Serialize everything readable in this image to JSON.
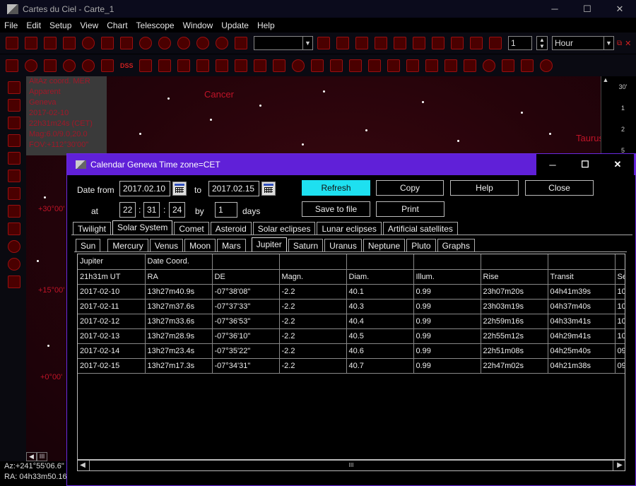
{
  "app": {
    "title": "Cartes du Ciel - Carte_1",
    "minimize": "─",
    "maximize": "☐",
    "close": "✕"
  },
  "menu": [
    "File",
    "Edit",
    "Setup",
    "View",
    "Chart",
    "Telescope",
    "Window",
    "Update",
    "Help"
  ],
  "toolbar": {
    "step_value": "1",
    "step_unit": "Hour"
  },
  "toolbar2": {
    "dss_label": "DSS"
  },
  "sky": {
    "info_lines": [
      "AltAz coord. MER",
      "Apparent",
      "Geneva",
      "2017-02-10",
      "22h31m24s (CET)",
      "Mag:6.0/9.0,20.0",
      "FOV:+112°30'00\""
    ],
    "constellations": [
      "Cancer",
      "Taurus"
    ],
    "grid_labels": [
      "+30°00'",
      "+15°00'",
      "+0°00'"
    ],
    "ruler": [
      "30'",
      "1",
      "2",
      "5"
    ]
  },
  "status": {
    "az": "Az:+241°55'06.6\"",
    "ra": "RA: 04h33m50.16"
  },
  "dialog": {
    "title": "Calendar Geneva Time zone=CET",
    "date_from_label": "Date from",
    "date_from": "2017.02.10",
    "to_label": "to",
    "date_to": "2017.02.15",
    "at_label": "at",
    "hour": "22",
    "minute": "31",
    "second": "24",
    "by_label": "by",
    "step": "1",
    "days_label": "days",
    "buttons": {
      "refresh": "Refresh",
      "copy": "Copy",
      "help": "Help",
      "close": "Close",
      "save": "Save to file",
      "print": "Print"
    },
    "tabs1": [
      "Twilight",
      "Solar System",
      "Comet",
      "Asteroid",
      "Solar eclipses",
      "Lunar eclipses",
      "Artificial satellites"
    ],
    "active_tab1": "Solar System",
    "tabs2": [
      "Sun",
      "Mercury",
      "Venus",
      "Moon",
      "Mars",
      "Jupiter",
      "Saturn",
      "Uranus",
      "Neptune",
      "Pluto",
      "Graphs"
    ],
    "active_tab2": "Jupiter",
    "grid": {
      "head1": [
        "Jupiter",
        "Date Coord.",
        "",
        "",
        "",
        "",
        "",
        "",
        ""
      ],
      "head2": [
        "21h31m UT",
        "RA",
        "DE",
        "Magn.",
        "Diam.",
        "Illum.",
        "Rise",
        "Transit",
        "Se"
      ],
      "rows": [
        [
          "2017-02-10",
          "13h27m40.9s",
          "-07°38'08\"",
          "-2.2",
          "40.1",
          "0.99",
          "23h07m20s",
          "04h41m39s",
          "10"
        ],
        [
          "2017-02-11",
          "13h27m37.6s",
          "-07°37'33\"",
          "-2.2",
          "40.3",
          "0.99",
          "23h03m19s",
          "04h37m40s",
          "10"
        ],
        [
          "2017-02-12",
          "13h27m33.6s",
          "-07°36'53\"",
          "-2.2",
          "40.4",
          "0.99",
          "22h59m16s",
          "04h33m41s",
          "10"
        ],
        [
          "2017-02-13",
          "13h27m28.9s",
          "-07°36'10\"",
          "-2.2",
          "40.5",
          "0.99",
          "22h55m12s",
          "04h29m41s",
          "10"
        ],
        [
          "2017-02-14",
          "13h27m23.4s",
          "-07°35'22\"",
          "-2.2",
          "40.6",
          "0.99",
          "22h51m08s",
          "04h25m40s",
          "09"
        ],
        [
          "2017-02-15",
          "13h27m17.3s",
          "-07°34'31\"",
          "-2.2",
          "40.7",
          "0.99",
          "22h47m02s",
          "04h21m38s",
          "09"
        ]
      ]
    }
  }
}
